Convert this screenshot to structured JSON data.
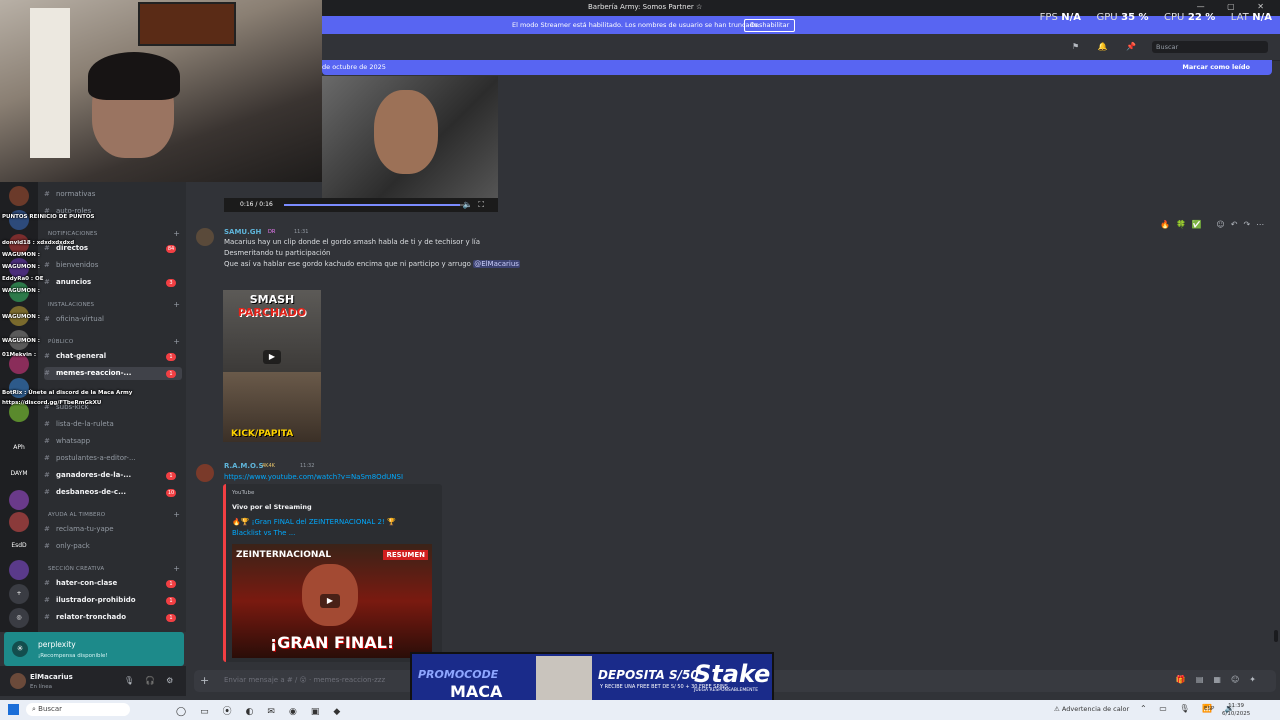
{
  "window": {
    "title": "Barbería Army: Somos Partner ☆"
  },
  "stats": {
    "fps_label": "FPS",
    "fps": "N/A",
    "gpu_label": "GPU",
    "gpu": "35 %",
    "cpu_label": "CPU",
    "cpu": "22 %",
    "lat_label": "LAT",
    "lat": "N/A"
  },
  "streamer": {
    "message": "El modo Streamer está habilitado. Los nombres de usuario se han truncado.",
    "button": "Deshabilitar"
  },
  "header": {
    "search_placeholder": "Buscar"
  },
  "new_messages": {
    "date": "de octubre de 2025",
    "mark_read": "Marcar como leído"
  },
  "sidebar": {
    "categories": [
      {
        "label": "NOTIFICACIONES"
      },
      {
        "label": "INSTALACIONES"
      },
      {
        "label": "PÚBLICO"
      },
      {
        "label": "AYUDA AL TIMBERO"
      },
      {
        "label": "SECCIÓN CREATIVA"
      }
    ],
    "channels": [
      {
        "label": "normativas",
        "badge": ""
      },
      {
        "label": "auto-roles",
        "badge": ""
      },
      {
        "label": "directos",
        "badge": "84"
      },
      {
        "label": "bienvenidos",
        "badge": ""
      },
      {
        "label": "anuncios",
        "badge": "3"
      },
      {
        "label": "oficina-virtual",
        "badge": ""
      },
      {
        "label": "chat-general",
        "badge": "1"
      },
      {
        "label": "memes-reaccion-...",
        "badge": "1"
      },
      {
        "label": "subs-kick",
        "badge": ""
      },
      {
        "label": "lista-de-la-ruleta",
        "badge": ""
      },
      {
        "label": "whatsapp",
        "badge": ""
      },
      {
        "label": "postulantes-a-editor-...",
        "badge": ""
      },
      {
        "label": "ganadores-de-la-...",
        "badge": "1"
      },
      {
        "label": "desbaneos-de-c...",
        "badge": "10"
      },
      {
        "label": "reclama-tu-yape",
        "badge": ""
      },
      {
        "label": "only-pack",
        "badge": ""
      },
      {
        "label": "hater-con-clase",
        "badge": "1"
      },
      {
        "label": "ilustrador-prohibido",
        "badge": "1"
      },
      {
        "label": "relator-tronchado",
        "badge": "1"
      }
    ],
    "rail": [
      "APh",
      "DAYM",
      "EsdD"
    ]
  },
  "overlay_chat": {
    "lines": [
      "PUNTOS   REINICIO DE PUNTOS",
      "donvid18 : xdxdxdxdxd",
      "WAGUMON :",
      "WAGUMON :",
      "EddyRa0 : OE",
      "WAGUMON :",
      "WAGUMON :",
      "WAGUMON :",
      "01Mekvin :",
      "BotRix : Únete al discord de la Maca Army",
      "https://discord.gg/FTbeRmGkXU"
    ]
  },
  "video": {
    "time": "0:16 / 0:16",
    "progress": 0.98
  },
  "messages": [
    {
      "user": "SAMU.GH",
      "tag": "DR",
      "time": "11:31",
      "lines": [
        "Macarius hay un clip donde el gordo smash habla de ti y de techisor y lía",
        "Desmeritando tu participación",
        "Que así va hablar ese gordo kachudo encima que ni participo y arrugo"
      ],
      "mention": "@ElMacarius"
    },
    {
      "user": "R.A.M.O.S",
      "tag": "4K4K",
      "time": "11:32",
      "link": "https://www.youtube.com/watch?v=NaSm8OdUNSI"
    }
  ],
  "thumb1": {
    "line1": "SMASH",
    "line2": "PARCHADO",
    "line3": "KICK/PAPITA"
  },
  "embed": {
    "provider": "YouTube",
    "author": "Vivo por el Streaming",
    "title": "🔥🏆 ¡Gran FINAL del ZEINTERNACIONAL 2! 🏆 Blacklist vs The ...",
    "img_label": "ZEINTERNACIONAL",
    "img_badge": "RESUMEN",
    "img_big": "¡GRAN FINAL!"
  },
  "perplexity": {
    "name": "perplexity",
    "status": "¡Recompensa disponible!"
  },
  "user": {
    "name": "ElMacarius",
    "status": "En línea"
  },
  "composer": {
    "placeholder": "Enviar mensaje a # / 😮 · memes-reaccion-zzz"
  },
  "ad": {
    "promo": "PROMOCODE",
    "code": "MACA",
    "deposit": "DEPOSITA S/50",
    "deposit_sub": "Y RECIBE UNA FREE BET DE S/ 50 + 30 FREE SPINS",
    "brand": "Stake",
    "brand_sub": "JUEGA RESPONSABLEMENTE"
  },
  "taskbar": {
    "search": "Buscar",
    "warning": "Advertencia de calor",
    "lang": "ESP",
    "time": "11:39",
    "date": "6/10/2025"
  }
}
